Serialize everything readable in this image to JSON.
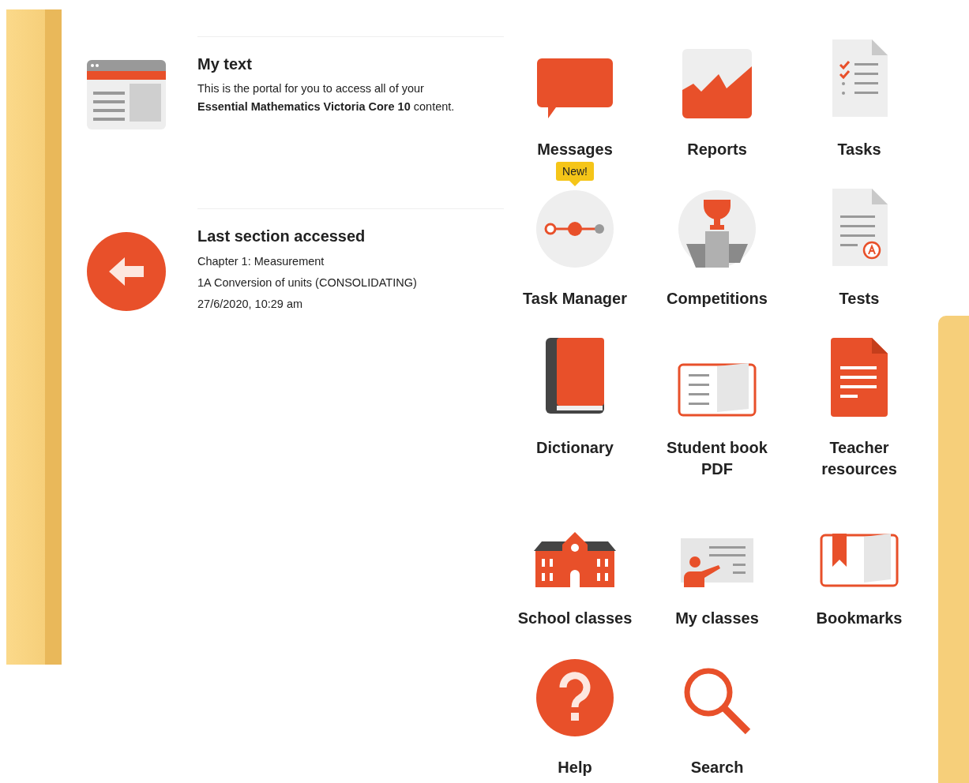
{
  "sections": [
    {
      "kind": "text",
      "title": "My text",
      "lines": [
        "This is the portal for you to access all of your **Essential Mathematics Victoria Core 10** content."
      ]
    },
    {
      "kind": "last",
      "title": "Last section accessed",
      "lines": [
        "Chapter 1: Measurement",
        "1A Conversion of units (CONSOLIDATING)",
        "27/6/2020, 10:29 am"
      ]
    }
  ],
  "tiles": [
    {
      "kind": "messages",
      "label": "Messages"
    },
    {
      "kind": "reports",
      "label": "Reports"
    },
    {
      "kind": "tasks",
      "label": "Tasks"
    },
    {
      "kind": "taskmanager",
      "label": "Task Manager",
      "badge": "New!"
    },
    {
      "kind": "competitions",
      "label": "Competitions"
    },
    {
      "kind": "tests",
      "label": "Tests"
    },
    {
      "kind": "dictionary",
      "label": "Dictionary"
    },
    {
      "kind": "studentbook",
      "label": "Student book PDF"
    },
    {
      "kind": "teacher",
      "label": "Teacher resources"
    },
    {
      "kind": "school",
      "label": "School classes"
    },
    {
      "kind": "myclasses",
      "label": "My classes"
    },
    {
      "kind": "bookmarks",
      "label": "Bookmarks"
    },
    {
      "kind": "help",
      "label": "Help"
    },
    {
      "kind": "search",
      "label": "Search"
    }
  ]
}
